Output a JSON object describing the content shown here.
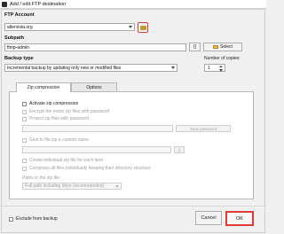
{
  "window": {
    "title": "Add / edit FTP destination"
  },
  "ftp_account": {
    "label": "FTP Account",
    "value": "altervista.org"
  },
  "subpath": {
    "label": "Subpath",
    "value": "ftmp-admin",
    "brackets_label": "{}",
    "select_label": "Select"
  },
  "backup_type": {
    "label": "Backup type",
    "value": "Incremental backup by updating only new or modified files"
  },
  "copies": {
    "label": "Number of copies:",
    "value": "1"
  },
  "tabs": [
    {
      "label": "Zip compression"
    },
    {
      "label": "Options"
    }
  ],
  "zip": {
    "activate": "Activate zip compression",
    "encrypt_all": "Encrypt the entire zip files with password",
    "protect": "Protect zip files with password",
    "save_password": "Save password",
    "custom_name": "Give to file zip a custom name",
    "brackets_label": "{}",
    "individual": "Create individual zip file for each item",
    "compress_all": "Compress all files individually keeping their directory structure",
    "paths_label": "Paths in the zip file:",
    "paths_value": "Full path including drive (recommended)"
  },
  "footer": {
    "exclude": "Exclude from backup",
    "cancel": "Cancel",
    "ok": "OK"
  }
}
